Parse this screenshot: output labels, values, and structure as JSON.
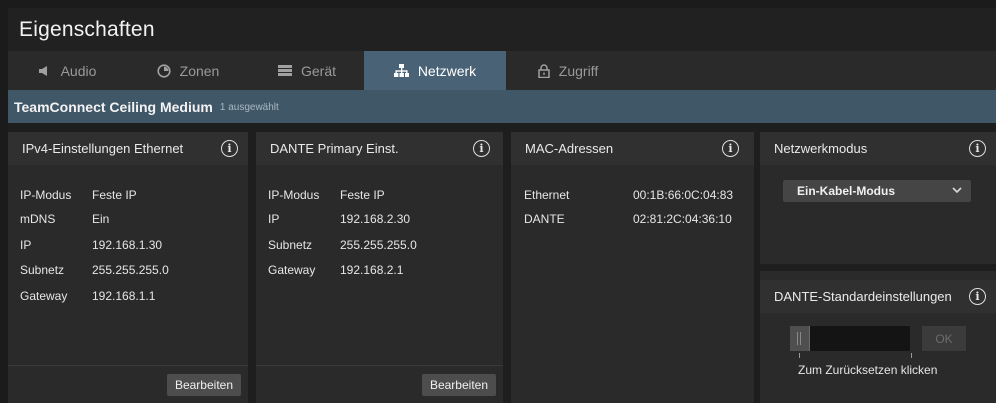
{
  "window": {
    "title": "Eigenschaften"
  },
  "tabs": [
    {
      "label": "Audio",
      "icon": "speaker-icon"
    },
    {
      "label": "Zonen",
      "icon": "zones-icon"
    },
    {
      "label": "Gerät",
      "icon": "device-icon"
    },
    {
      "label": "Netzwerk",
      "icon": "network-icon",
      "active": true
    },
    {
      "label": "Zugriff",
      "icon": "lock-icon"
    }
  ],
  "selection": {
    "device": "TeamConnect Ceiling Medium",
    "count": "1 ausgewählt"
  },
  "ipv4": {
    "title": "IPv4-Einstellungen Ethernet",
    "rows": [
      {
        "key": "IP-Modus",
        "value": "Feste IP"
      },
      {
        "key": "mDNS",
        "value": "Ein"
      },
      {
        "key": "IP",
        "value": "192.168.1.30"
      },
      {
        "key": "Subnetz",
        "value": "255.255.255.0"
      },
      {
        "key": "Gateway",
        "value": "192.168.1.1"
      }
    ],
    "button": "Bearbeiten"
  },
  "dante": {
    "title": "DANTE Primary Einst.",
    "rows": [
      {
        "key": "IP-Modus",
        "value": "Feste IP"
      },
      {
        "key": "IP",
        "value": "192.168.2.30"
      },
      {
        "key": "Subnetz",
        "value": "255.255.255.0"
      },
      {
        "key": "Gateway",
        "value": "192.168.2.1"
      }
    ],
    "button": "Bearbeiten"
  },
  "mac": {
    "title": "MAC-Adressen",
    "rows": [
      {
        "key": "Ethernet",
        "value": "00:1B:66:0C:04:83"
      },
      {
        "key": "DANTE",
        "value": "02:81:2C:04:36:10"
      }
    ]
  },
  "netmode": {
    "title": "Netzwerkmodus",
    "selected": "Ein-Kabel-Modus"
  },
  "dante_reset": {
    "title": "DANTE-Standardeinstellungen",
    "ok_label": "OK",
    "hint": "Zum Zurücksetzen klicken",
    "slider_progress": 0
  },
  "colors": {
    "active_tab": "#4a6276",
    "selection_bar": "#405767",
    "panel": "#2a2a2a"
  }
}
